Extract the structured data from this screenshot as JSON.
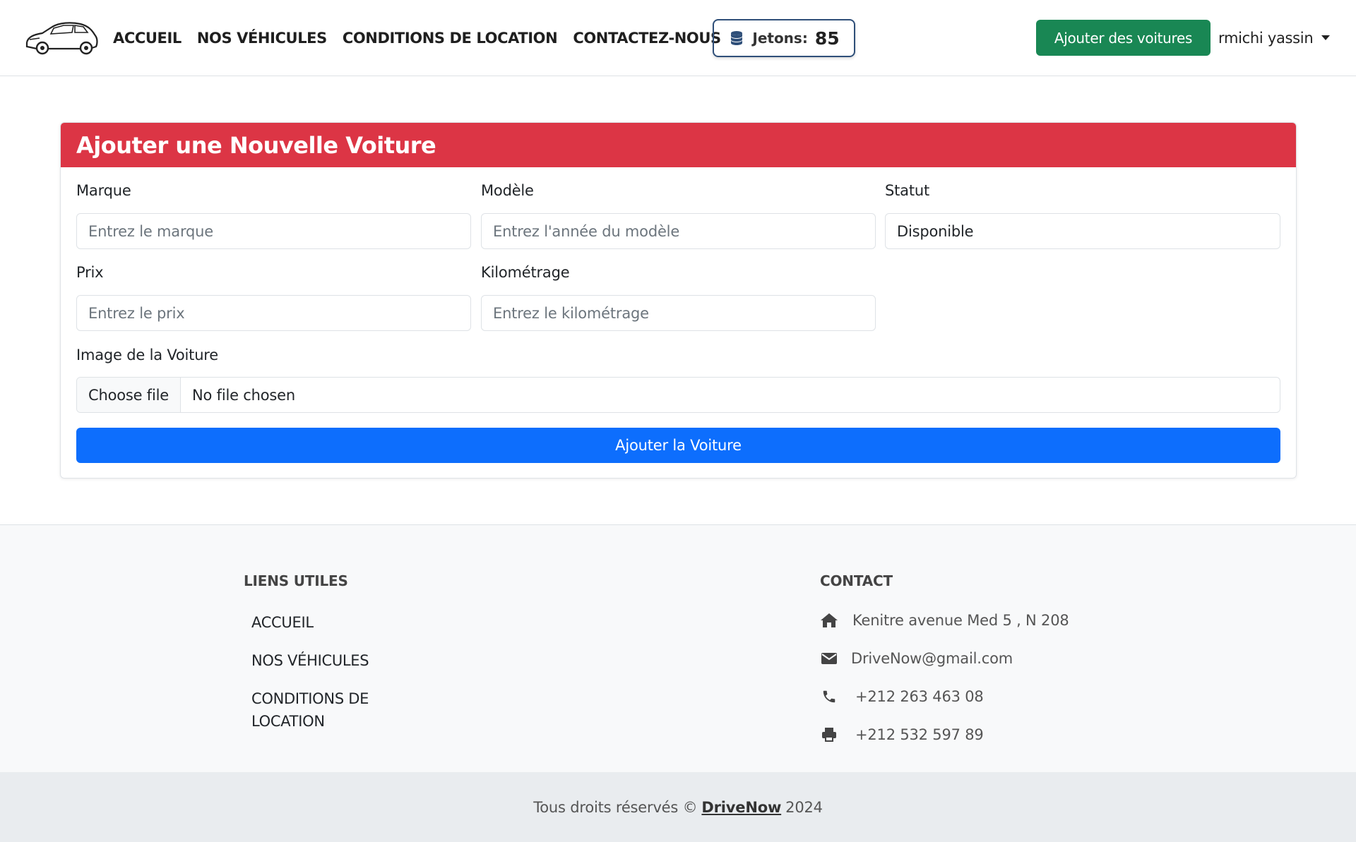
{
  "nav": {
    "links": [
      {
        "label": "ACCUEIL"
      },
      {
        "label": "NOS VÉHICULES"
      },
      {
        "label": "CONDITIONS DE LOCATION"
      },
      {
        "label": "CONTACTEZ-NOUS"
      }
    ],
    "tokens_label": "Jetons:",
    "tokens_value": "85",
    "add_cars_label": "Ajouter des voitures",
    "user_name": "rmichi yassin"
  },
  "form": {
    "title": "Ajouter une Nouvelle Voiture",
    "marque_label": "Marque",
    "marque_placeholder": "Entrez le marque",
    "modele_label": "Modèle",
    "modele_placeholder": "Entrez l'année du modèle",
    "statut_label": "Statut",
    "statut_value": "Disponible",
    "prix_label": "Prix",
    "prix_placeholder": "Entrez le prix",
    "km_label": "Kilométrage",
    "km_placeholder": "Entrez le kilométrage",
    "image_label": "Image de la Voiture",
    "file_button": "Choose file",
    "file_status": "No file chosen",
    "submit_label": "Ajouter la Voiture"
  },
  "footer": {
    "links_heading": "LIENS UTILES",
    "links": [
      "ACCUEIL",
      "NOS VÉHICULES",
      "CONDITIONS DE",
      "LOCATION"
    ],
    "contact_heading": "CONTACT",
    "address": "Kenitre avenue Med 5 , N 208",
    "email": "DriveNow@gmail.com",
    "phone": "+212 263 463 08",
    "fax": "+212 532 597 89",
    "copyright_prefix": "Tous droits réservés ©",
    "brand": "DriveNow",
    "year": "2024"
  },
  "colors": {
    "header_red": "#dc3545",
    "primary_blue": "#0d6efd",
    "success_green": "#198754",
    "token_border": "#2f4f79"
  },
  "icons": [
    "car-logo",
    "coins-icon",
    "home-icon",
    "envelope-icon",
    "phone-icon",
    "printer-icon"
  ]
}
